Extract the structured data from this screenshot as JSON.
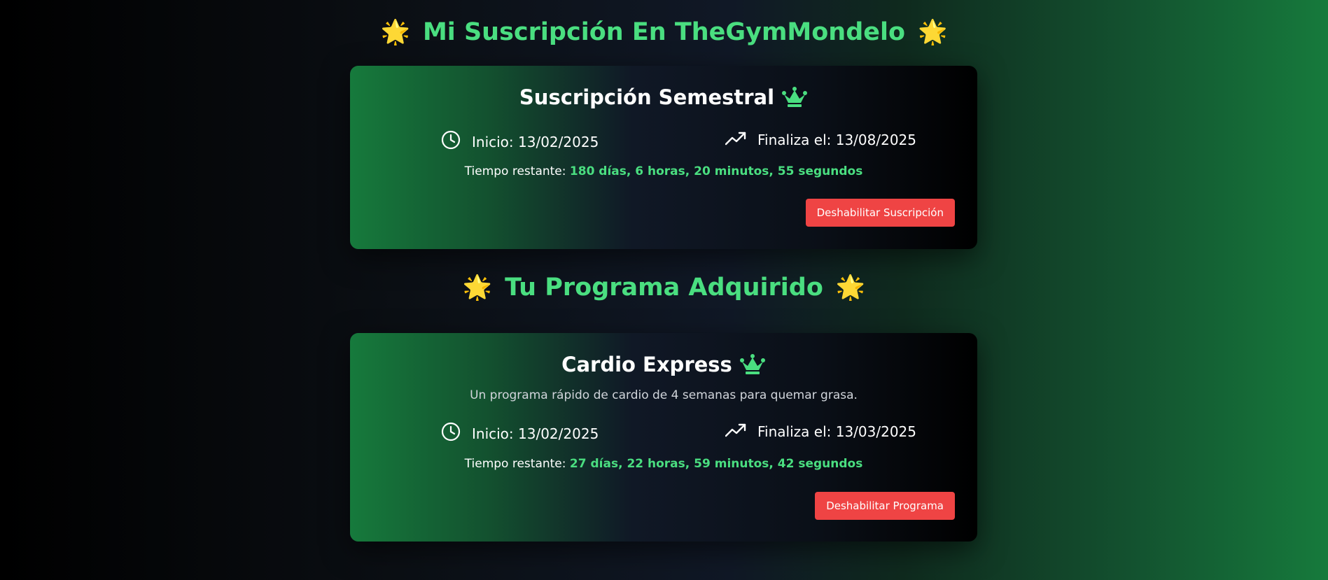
{
  "subscription_section": {
    "title": "Mi Suscripción En TheGymMondelo",
    "star_icon": "star-icon"
  },
  "subscription_card": {
    "title": "Suscripción Semestral",
    "start_label": "Inicio: 13/02/2025",
    "end_label": "Finaliza el: 13/08/2025",
    "remaining_label": "Tiempo restante:",
    "remaining_value": "180 días, 6 horas, 20 minutos, 55 segundos",
    "disable_button": "Deshabilitar Suscripción"
  },
  "program_section": {
    "title": "Tu Programa Adquirido",
    "star_icon": "star-icon"
  },
  "program_card": {
    "title": "Cardio Express",
    "description": "Un programa rápido de cardio de 4 semanas para quemar grasa.",
    "start_label": "Inicio: 13/02/2025",
    "end_label": "Finaliza el: 13/03/2025",
    "remaining_label": "Tiempo restante:",
    "remaining_value": "27 días, 22 horas, 59 minutos, 42 segundos",
    "disable_button": "Deshabilitar Programa"
  },
  "colors": {
    "accent_green": "#4ade80",
    "star_yellow": "#facc15",
    "danger_red": "#ef4444"
  }
}
